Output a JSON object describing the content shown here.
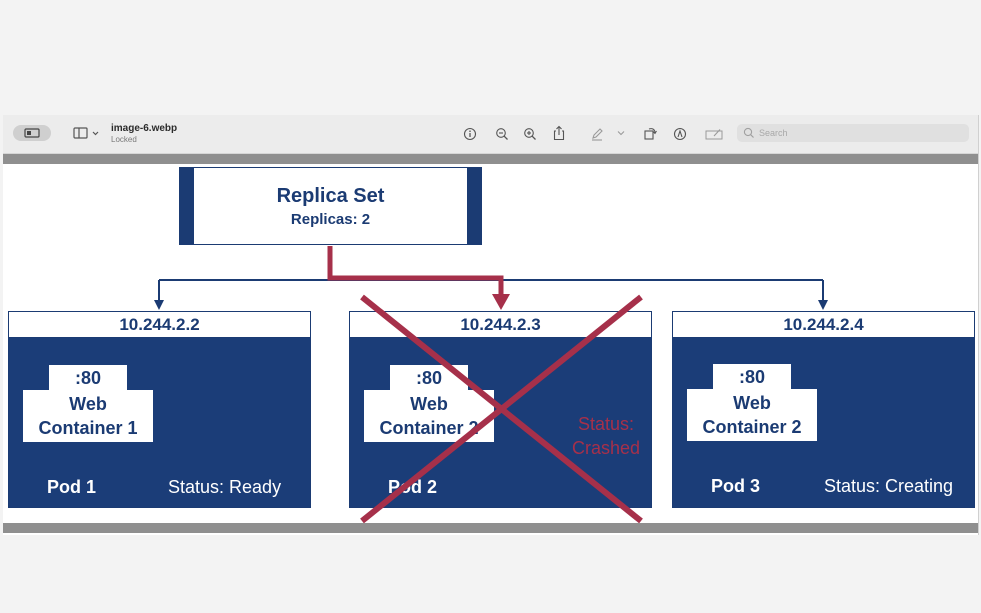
{
  "toolbar": {
    "file_name": "image-6.webp",
    "file_status": "Locked",
    "search_placeholder": "Search"
  },
  "slide": {
    "replica_set": {
      "title": "Replica Set",
      "replicas": "Replicas: 2"
    },
    "pods": [
      {
        "ip": "10.244.2.2",
        "port": ":80",
        "container_line1": "Web",
        "container_line2": "Container 1",
        "name": "Pod 1",
        "status": "Status: Ready"
      },
      {
        "ip": "10.244.2.3",
        "port": ":80",
        "container_line1": "Web",
        "container_line2": "Container 2",
        "name": "Pod 2",
        "status_line1": "Status:",
        "status_line2": "Crashed"
      },
      {
        "ip": "10.244.2.4",
        "port": ":80",
        "container_line1": "Web",
        "container_line2": "Container 2",
        "name": "Pod 3",
        "status": "Status: Creating"
      }
    ]
  },
  "colors": {
    "navy": "#1b3d78",
    "crimson": "#a6304a"
  }
}
